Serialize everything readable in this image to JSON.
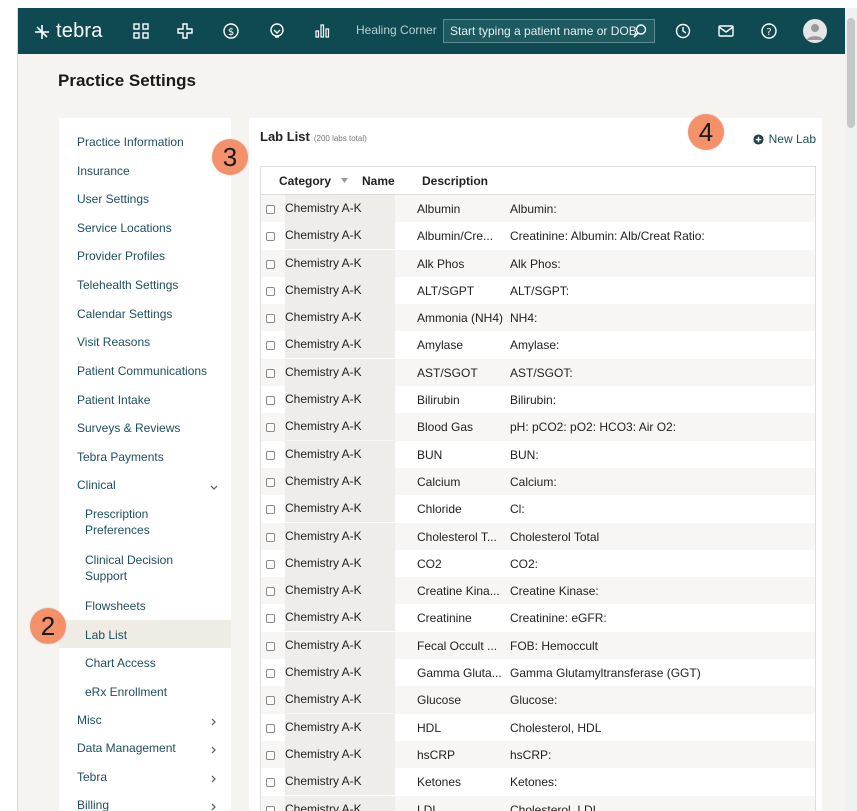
{
  "topbar": {
    "logo_text": "tebra",
    "practice_name": "Healing Corner",
    "search_placeholder": "Start typing a patient name or DOB",
    "nav_icons": [
      "dashboard-icon",
      "clinical-icon",
      "billing-icon",
      "engage-icon",
      "reports-icon"
    ],
    "right_icons": [
      "history-icon",
      "messages-icon",
      "help-icon",
      "avatar"
    ],
    "bg_color": "#0f4a52"
  },
  "page_title": "Practice Settings",
  "sidebar": {
    "items": [
      {
        "label": "Practice Information"
      },
      {
        "label": "Insurance"
      },
      {
        "label": "User Settings"
      },
      {
        "label": "Service Locations"
      },
      {
        "label": "Provider Profiles"
      },
      {
        "label": "Telehealth Settings"
      },
      {
        "label": "Calendar Settings"
      },
      {
        "label": "Visit Reasons"
      },
      {
        "label": "Patient Communications"
      },
      {
        "label": "Patient Intake"
      },
      {
        "label": "Surveys & Reviews"
      },
      {
        "label": "Tebra Payments"
      },
      {
        "label": "Clinical",
        "chevron": "down"
      }
    ],
    "sub_items": [
      {
        "label": "Prescription Preferences"
      },
      {
        "label": "Clinical Decision Support"
      },
      {
        "label": "Flowsheets"
      },
      {
        "label": "Lab List",
        "active": true
      },
      {
        "label": "Chart Access"
      },
      {
        "label": "eRx Enrollment"
      }
    ],
    "bottom_items": [
      {
        "label": "Misc",
        "chevron": "right"
      },
      {
        "label": "Data Management",
        "chevron": "right"
      },
      {
        "label": "Tebra",
        "chevron": "right"
      },
      {
        "label": "Billing",
        "chevron": "right"
      }
    ]
  },
  "markers": {
    "m2": "2",
    "m3": "3",
    "m4": "4",
    "color": "#f4916a"
  },
  "lab_list": {
    "title": "Lab List",
    "count": "(200 labs total)",
    "new_lab_label": "New Lab",
    "columns": [
      "Category",
      "Name",
      "Description"
    ],
    "rows": [
      [
        "Chemistry A-K",
        "Albumin",
        "Albumin:"
      ],
      [
        "Chemistry A-K",
        "Albumin/Cre...",
        "Creatinine: Albumin: Alb/Creat Ratio:"
      ],
      [
        "Chemistry A-K",
        "Alk Phos",
        "Alk Phos:"
      ],
      [
        "Chemistry A-K",
        "ALT/SGPT",
        "ALT/SGPT:"
      ],
      [
        "Chemistry A-K",
        "Ammonia (NH4)",
        "NH4:"
      ],
      [
        "Chemistry A-K",
        "Amylase",
        "Amylase:"
      ],
      [
        "Chemistry A-K",
        "AST/SGOT",
        "AST/SGOT:"
      ],
      [
        "Chemistry A-K",
        "Bilirubin",
        "Bilirubin:"
      ],
      [
        "Chemistry A-K",
        "Blood Gas",
        "pH: pCO2: pO2: HCO3: Air O2:"
      ],
      [
        "Chemistry A-K",
        "BUN",
        "BUN:"
      ],
      [
        "Chemistry A-K",
        "Calcium",
        "Calcium:"
      ],
      [
        "Chemistry A-K",
        "Chloride",
        "Cl:"
      ],
      [
        "Chemistry A-K",
        "Cholesterol T...",
        "Cholesterol Total"
      ],
      [
        "Chemistry A-K",
        "CO2",
        "CO2:"
      ],
      [
        "Chemistry A-K",
        "Creatine Kina...",
        "Creatine Kinase:"
      ],
      [
        "Chemistry A-K",
        "Creatinine",
        "Creatinine: eGFR:"
      ],
      [
        "Chemistry A-K",
        "Fecal Occult ...",
        "FOB: Hemoccult"
      ],
      [
        "Chemistry A-K",
        "Gamma Gluta...",
        "Gamma Glutamyltransferase (GGT)"
      ],
      [
        "Chemistry A-K",
        "Glucose",
        "Glucose:"
      ],
      [
        "Chemistry A-K",
        "HDL",
        "Cholesterol, HDL"
      ],
      [
        "Chemistry A-K",
        "hsCRP",
        "hsCRP:"
      ],
      [
        "Chemistry A-K",
        "Ketones",
        "Ketones:"
      ],
      [
        "Chemistry A-K",
        "LDL",
        "Cholesterol, LDL"
      ]
    ]
  }
}
